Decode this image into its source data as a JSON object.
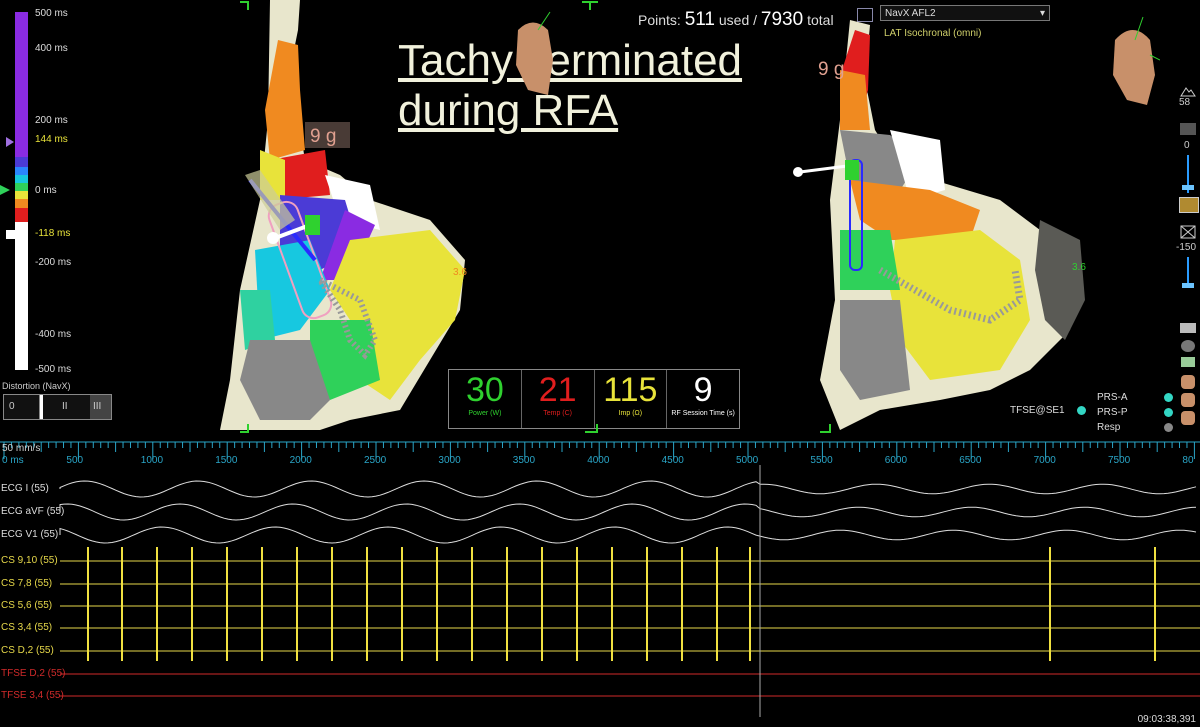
{
  "overlay": {
    "title_line1": "Tachy Terminated",
    "title_line2": "during RFA"
  },
  "header": {
    "points_label": "Points:",
    "points_used": "511",
    "used_label": "used /",
    "points_total": "7930",
    "total_label": "total",
    "map_name": "NavX AFL2",
    "map_mode": "LAT Isochronal (omni)"
  },
  "color_scale": {
    "labels": [
      "500 ms",
      "400 ms",
      "200 ms",
      "144 ms",
      "0 ms",
      "-118 ms",
      "-200 ms",
      "-400 ms",
      "-500 ms"
    ]
  },
  "map_annotations": {
    "force_left": "9 g",
    "force_right": "9 g",
    "value_left": "3.6",
    "value_right": "3.6"
  },
  "distortion": {
    "label": "Distortion (NavX)",
    "value": "0",
    "marks": [
      "II",
      "III"
    ]
  },
  "rf_panel": {
    "items": [
      {
        "value": "30",
        "label": "Power (W)",
        "color": "#2fd12f"
      },
      {
        "value": "21",
        "label": "Temp (C)",
        "color": "#e01e1e"
      },
      {
        "value": "115",
        "label": "Imp (Ω)",
        "color": "#e8e33a"
      },
      {
        "value": "9",
        "label": "RF Session Time (s)",
        "color": "#ffffff"
      }
    ]
  },
  "right_toolbar": {
    "value_58": "58",
    "value_0": "0",
    "value_minus150": "-150"
  },
  "resp_legend": {
    "source": "TFSE@SE1",
    "items": [
      {
        "label": "PRS-A",
        "color": "#33d6c4"
      },
      {
        "label": "PRS-P",
        "color": "#33d6c4"
      },
      {
        "label": "Resp",
        "color": "#888888"
      }
    ]
  },
  "ruler": {
    "speed": "50 mm/s",
    "start": "0 ms",
    "ticks": [
      "500",
      "1000",
      "1500",
      "2000",
      "2500",
      "3000",
      "3500",
      "4000",
      "4500",
      "5000",
      "5500",
      "6000",
      "6500",
      "7000",
      "7500",
      "80"
    ]
  },
  "channels": [
    {
      "label": "ECG I (55)",
      "color": "#dddddd"
    },
    {
      "label": "ECG aVF (55)",
      "color": "#dddddd"
    },
    {
      "label": "ECG V1 (55)",
      "color": "#dddddd"
    },
    {
      "label": "CS 9,10 (55)",
      "color": "#e6d84a"
    },
    {
      "label": "CS 7,8 (55)",
      "color": "#e6d84a"
    },
    {
      "label": "CS 5,6 (55)",
      "color": "#e6d84a"
    },
    {
      "label": "CS 3,4 (55)",
      "color": "#e6d84a"
    },
    {
      "label": "CS D,2 (55)",
      "color": "#e6d84a"
    },
    {
      "label": "TFSE D,2 (55)",
      "color": "#d02a2a"
    },
    {
      "label": "TFSE 3,4 (55)",
      "color": "#d02a2a"
    }
  ],
  "status": {
    "timestamp": "09:03:38,391"
  }
}
